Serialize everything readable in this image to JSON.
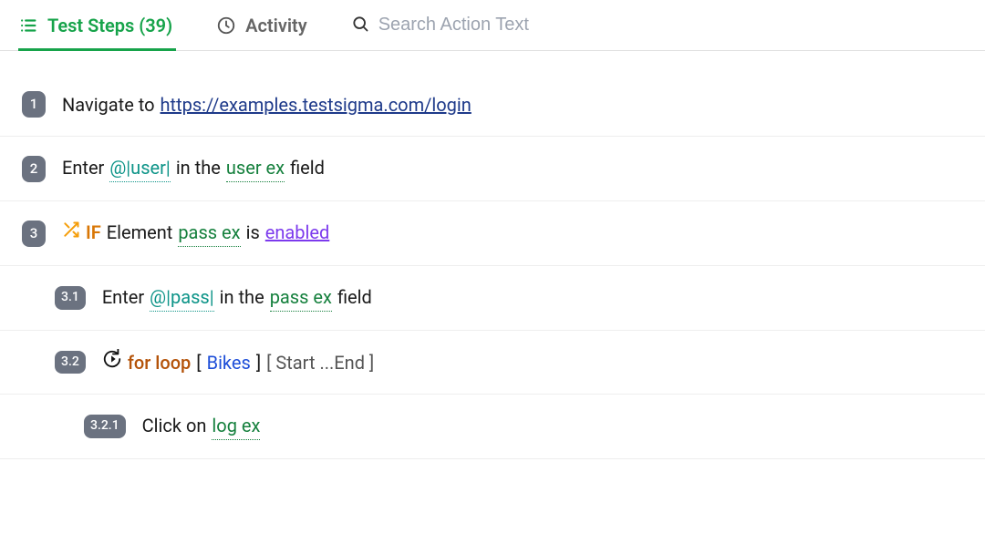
{
  "tabs": {
    "test_steps_label": "Test Steps (39)",
    "activity_label": "Activity"
  },
  "search": {
    "placeholder": "Search Action Text"
  },
  "steps": [
    {
      "badge": "1",
      "parts": [
        {
          "text": "Navigate to",
          "cls": ""
        },
        {
          "text": "https://examples.testsigma.com/login",
          "cls": "link",
          "name": "url-link",
          "interactable": true
        }
      ],
      "indent": 0
    },
    {
      "badge": "2",
      "parts": [
        {
          "text": "Enter",
          "cls": ""
        },
        {
          "text": "@|user|",
          "cls": "var-teal",
          "name": "variable-user",
          "interactable": true
        },
        {
          "text": "in the",
          "cls": ""
        },
        {
          "text": "user ex",
          "cls": "var-green",
          "name": "element-user-ex",
          "interactable": true
        },
        {
          "text": "field",
          "cls": ""
        }
      ],
      "indent": 0
    },
    {
      "badge": "3",
      "prefix": "if",
      "parts": [
        {
          "text": "IF",
          "cls": "kw-if"
        },
        {
          "text": "Element",
          "cls": ""
        },
        {
          "text": "pass ex",
          "cls": "var-green",
          "name": "element-pass-ex",
          "interactable": true
        },
        {
          "text": "is",
          "cls": ""
        },
        {
          "text": "enabled",
          "cls": "var-purple",
          "name": "condition-enabled",
          "interactable": true
        }
      ],
      "indent": 0
    },
    {
      "badge": "3.1",
      "parts": [
        {
          "text": "Enter",
          "cls": ""
        },
        {
          "text": "@|pass|",
          "cls": "var-teal",
          "name": "variable-pass",
          "interactable": true
        },
        {
          "text": "in the",
          "cls": ""
        },
        {
          "text": "pass ex",
          "cls": "var-green",
          "name": "element-pass-ex",
          "interactable": true
        },
        {
          "text": "field",
          "cls": ""
        }
      ],
      "indent": 1
    },
    {
      "badge": "3.2",
      "prefix": "loop",
      "parts": [
        {
          "text": "for loop",
          "cls": "kw-for"
        },
        {
          "text": "[",
          "cls": "bracket"
        },
        {
          "text": "Bikes",
          "cls": "var-blue",
          "name": "loop-data-bikes",
          "interactable": true
        },
        {
          "text": "]",
          "cls": "bracket"
        },
        {
          "text": " [ Start ...End ]",
          "cls": "muted"
        }
      ],
      "indent": 1
    },
    {
      "badge": "3.2.1",
      "parts": [
        {
          "text": "Click on",
          "cls": ""
        },
        {
          "text": "log ex",
          "cls": "var-green",
          "name": "element-log-ex",
          "interactable": true
        }
      ],
      "indent": 2
    }
  ]
}
